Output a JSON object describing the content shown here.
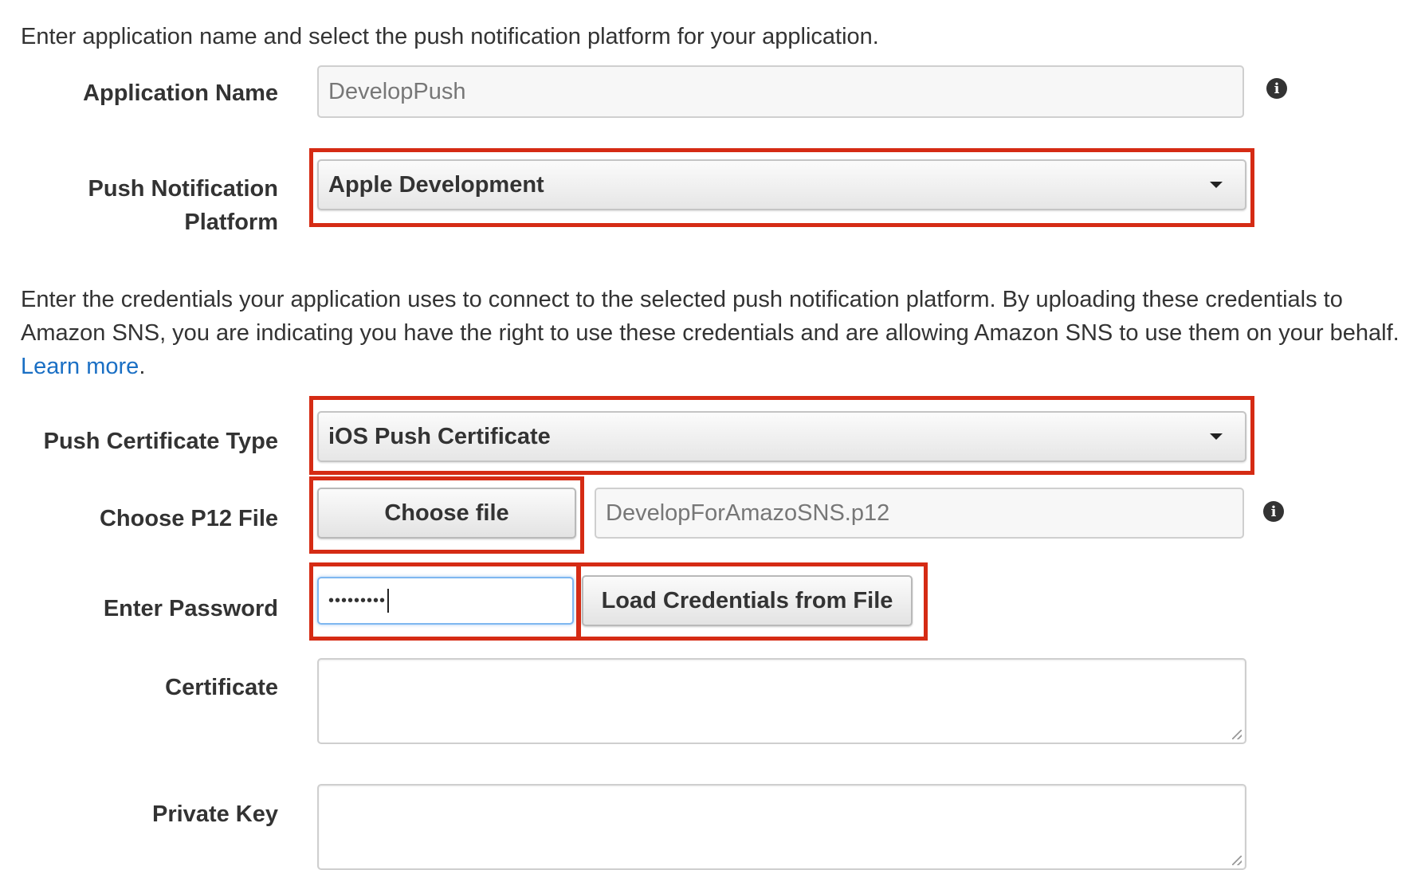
{
  "intro_text": "Enter application name and select the push notification platform for your application.",
  "app_name": {
    "label": "Application Name",
    "value": "DevelopPush"
  },
  "platform": {
    "label_line1": "Push Notification",
    "label_line2": "Platform",
    "selected": "Apple Development"
  },
  "credentials_text": {
    "line1": "Enter the credentials your application uses to connect to the selected push notification platform. By uploading these credentials to",
    "line2": "Amazon SNS, you are indicating you have the right to use these credentials and are allowing Amazon SNS to use them on your behalf.",
    "learn_more": "Learn more",
    "period": "."
  },
  "cert_type": {
    "label": "Push Certificate Type",
    "selected": "iOS Push Certificate"
  },
  "p12": {
    "label": "Choose P12 File",
    "button": "Choose file",
    "filename": "DevelopForAmazoSNS.p12"
  },
  "password": {
    "label": "Enter Password",
    "masked": "•••••••••",
    "load_button": "Load Credentials from File"
  },
  "certificate": {
    "label": "Certificate",
    "value": ""
  },
  "private_key": {
    "label": "Private Key",
    "value": ""
  },
  "icons": {
    "info": "info-icon",
    "dropdown": "chevron-down-icon"
  },
  "colors": {
    "highlight": "#d52b14",
    "link": "#1a6fc4",
    "text": "#333333"
  }
}
